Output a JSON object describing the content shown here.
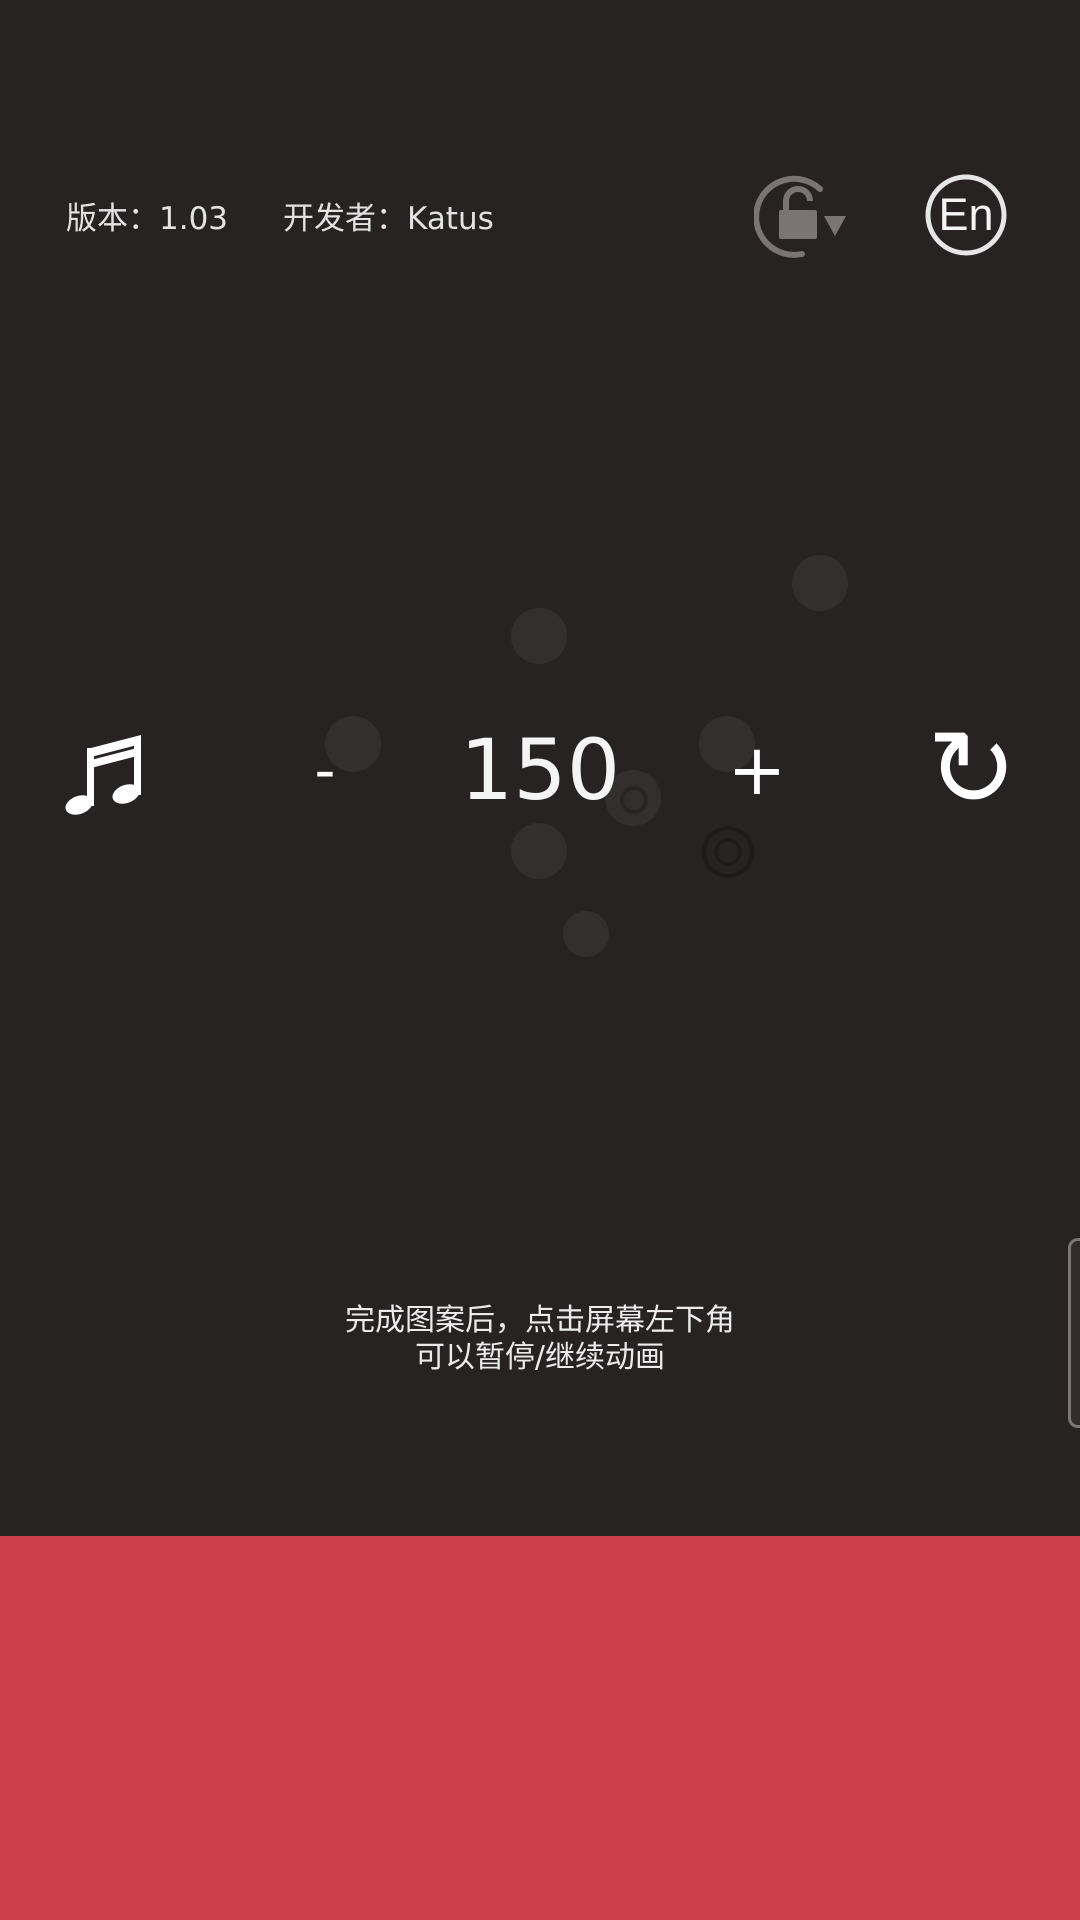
{
  "header": {
    "version": "版本：1.03",
    "developer": "开发者：Katus"
  },
  "icons": {
    "rotate_lock": "rotation-lock-icon",
    "language": "language-en-icon",
    "language_text": "En",
    "music": "music-note-icon",
    "refresh": "refresh-icon"
  },
  "controls": {
    "decrease": "-",
    "value": "150",
    "increase": "+",
    "refresh": "↻"
  },
  "hint": {
    "line1": "完成图案后，点击屏幕左下角",
    "line2": "可以暂停/继续动画"
  },
  "colors": {
    "background": "#282323",
    "bottom_band": "#cd3f4b",
    "text": "#f2f2f2"
  }
}
